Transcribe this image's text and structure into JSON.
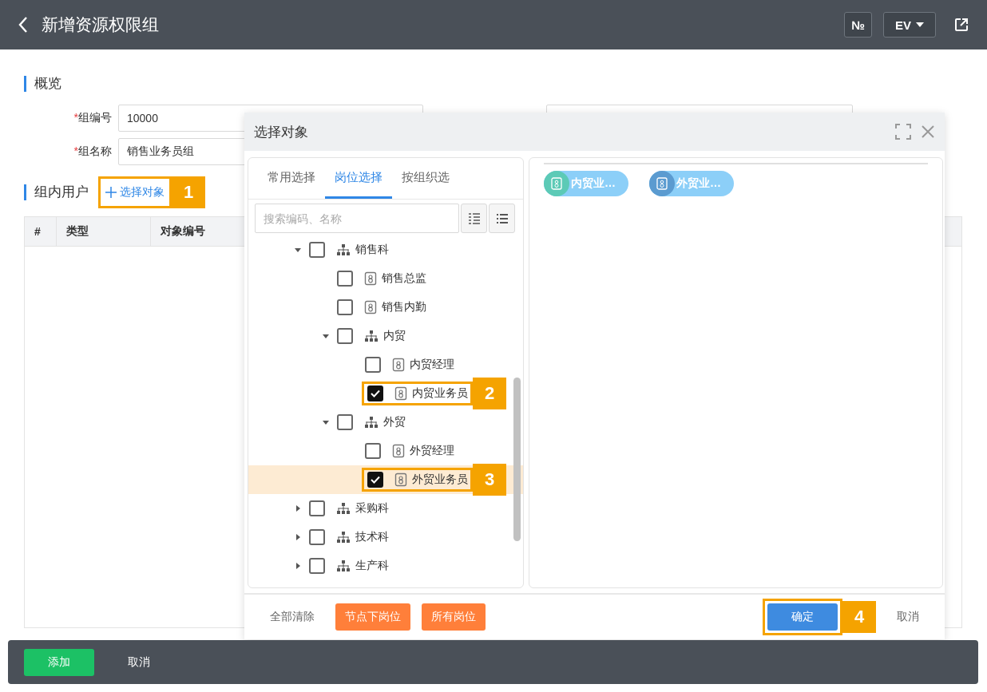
{
  "header": {
    "title": "新增资源权限组",
    "number_button": "№",
    "language_select": "EV"
  },
  "overview": {
    "heading": "概览",
    "fields": [
      {
        "label": "组编号",
        "required_mark": "*",
        "value": "10000"
      },
      {
        "label": "组名称",
        "required_mark": "*",
        "value": "销售业务员组"
      }
    ]
  },
  "members": {
    "heading": "组内用户",
    "add_button": {
      "label": "选择对象",
      "callout": "1"
    },
    "columns": [
      "#",
      "类型",
      "对象编号"
    ]
  },
  "dialog": {
    "title": "选择对象",
    "tabs": [
      {
        "label": "常用选择",
        "selected": false
      },
      {
        "label": "岗位选择",
        "selected": true
      },
      {
        "label": "按组织选",
        "selected": false
      }
    ],
    "search": {
      "placeholder": "搜索编码、名称"
    },
    "tree": [
      {
        "label": "销售科",
        "kind": "dept",
        "expanded": true,
        "checked": false,
        "selected": false,
        "children": [
          {
            "label": "销售总监",
            "kind": "post",
            "checked": false,
            "selected": false
          },
          {
            "label": "销售内勤",
            "kind": "post",
            "checked": false,
            "selected": false
          },
          {
            "label": "内贸",
            "kind": "dept",
            "expanded": true,
            "checked": false,
            "selected": false,
            "children": [
              {
                "label": "内贸经理",
                "kind": "post",
                "checked": false,
                "selected": false
              },
              {
                "label": "内贸业务员",
                "kind": "post",
                "checked": true,
                "selected": false,
                "callout": "2"
              }
            ]
          },
          {
            "label": "外贸",
            "kind": "dept",
            "expanded": true,
            "checked": false,
            "selected": false,
            "children": [
              {
                "label": "外贸经理",
                "kind": "post",
                "checked": false,
                "selected": false
              },
              {
                "label": "外贸业务员",
                "kind": "post",
                "checked": true,
                "selected": true,
                "callout": "3"
              }
            ]
          }
        ]
      },
      {
        "label": "采购科",
        "kind": "dept",
        "expanded": false,
        "checked": false,
        "selected": false
      },
      {
        "label": "技术科",
        "kind": "dept",
        "expanded": false,
        "checked": false,
        "selected": false
      },
      {
        "label": "生产科",
        "kind": "dept",
        "expanded": false,
        "checked": false,
        "selected": false
      }
    ],
    "chips": [
      {
        "label": "内贸业…",
        "color": "#5ccab6"
      },
      {
        "label": "外贸业…",
        "color": "#5b9bd0"
      }
    ],
    "footer_buttons": [
      {
        "label": "全部清除",
        "kind": "text"
      },
      {
        "label": "节点下岗位",
        "kind": "orange"
      },
      {
        "label": "所有岗位",
        "kind": "orange"
      },
      {
        "label": "确定",
        "kind": "primary",
        "callout": "4"
      },
      {
        "label": "取消",
        "kind": "text"
      }
    ]
  },
  "bottom_bar": {
    "buttons": [
      {
        "label": "添加",
        "kind": "green"
      },
      {
        "label": "取消",
        "kind": "text"
      }
    ]
  }
}
